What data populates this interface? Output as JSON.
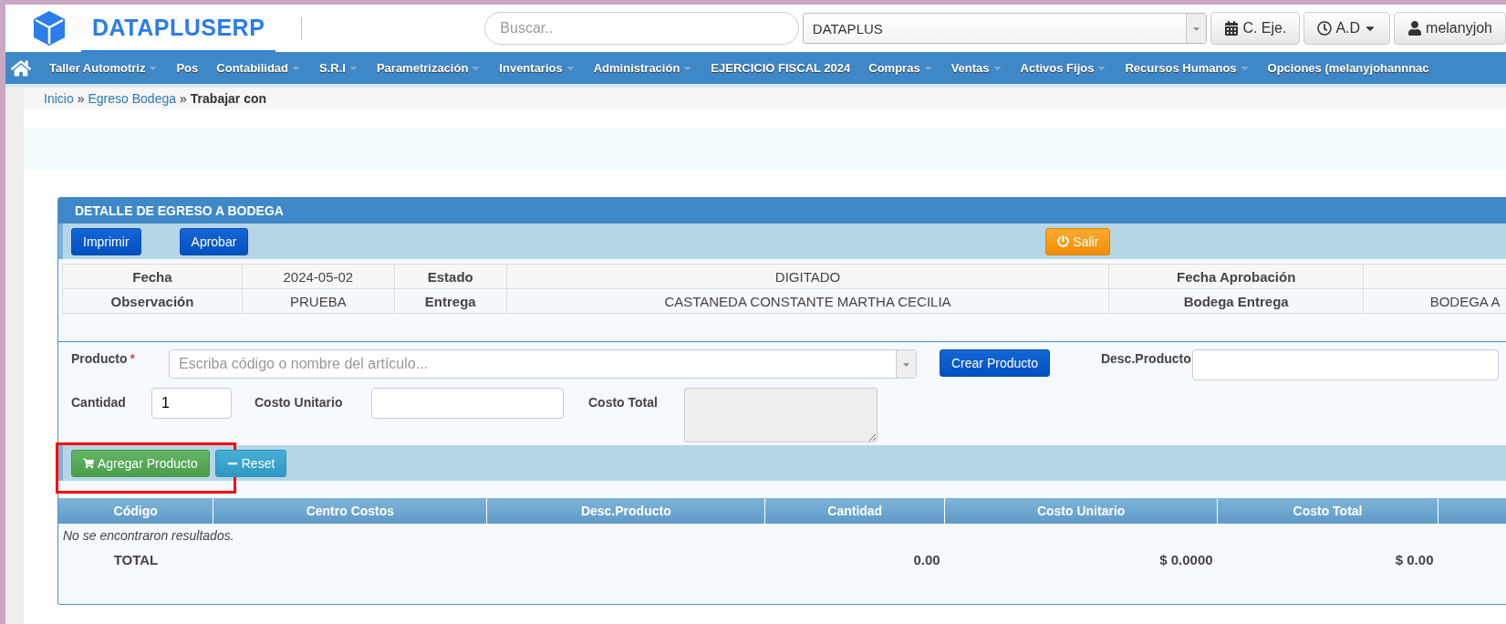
{
  "header": {
    "brand": "DATAPLUSERP",
    "search": {
      "placeholder": "Buscar.."
    },
    "company_select": {
      "value": "DATAPLUS"
    },
    "buttons": [
      {
        "kind": "calendar",
        "label": "C. Eje."
      },
      {
        "kind": "clock",
        "label": "A.D",
        "caret": true
      },
      {
        "kind": "user",
        "label": "melanyjoh"
      }
    ]
  },
  "nav": [
    {
      "label": "Taller Automotriz",
      "has_submenu": true
    },
    {
      "label": "Pos",
      "has_submenu": false
    },
    {
      "label": "Contabilidad",
      "has_submenu": true
    },
    {
      "label": "S.R.I",
      "has_submenu": true
    },
    {
      "label": "Parametrización",
      "has_submenu": true
    },
    {
      "label": "Inventarios",
      "has_submenu": true
    },
    {
      "label": "Administración",
      "has_submenu": true
    },
    {
      "label": "EJERCICIO FISCAL 2024",
      "has_submenu": false
    },
    {
      "label": "Compras",
      "has_submenu": true
    },
    {
      "label": "Ventas",
      "has_submenu": true
    },
    {
      "label": "Activos Fijos",
      "has_submenu": true
    },
    {
      "label": "Recursos Humanos",
      "has_submenu": true
    },
    {
      "label": "Opciones (melanyjohannnac",
      "has_submenu": false
    }
  ],
  "breadcrumb": [
    {
      "label": "Inicio",
      "link": true
    },
    {
      "label": "Egreso Bodega",
      "link": true
    },
    {
      "label": "Trabajar con",
      "link": false
    }
  ],
  "breadcrumb_separator": "»",
  "panel": {
    "title": "DETALLE DE EGRESO A BODEGA",
    "toolbar": [
      {
        "label": "Imprimir",
        "kind": "primary"
      },
      {
        "label": "Aprobar",
        "kind": "primary"
      },
      {
        "label": "Salir",
        "kind": "warning"
      }
    ],
    "info_rows": [
      [
        "Fecha",
        "2024-05-02",
        "Estado",
        "DIGITADO",
        "Fecha Aprobación",
        null
      ],
      [
        "Observación",
        "PRUEBA",
        "Entrega",
        "CASTANEDA CONSTANTE MARTHA CECILIA",
        "Bodega Entrega",
        "BODEGA A"
      ]
    ],
    "form": {
      "producto": {
        "label": "Producto",
        "required_mark": "*",
        "placeholder": "Escriba código o nombre del artículo..."
      },
      "crear_button": "Crear Producto",
      "desc": {
        "label": "Desc.Producto"
      },
      "cantidad": {
        "label": "Cantidad",
        "value": "1"
      },
      "costo_unitario": {
        "label": "Costo Unitario"
      },
      "costo_total": {
        "label": "Costo Total"
      }
    },
    "actions": [
      {
        "label": "Agregar Producto",
        "kind": "success",
        "highlighted": true
      },
      {
        "label": "Reset",
        "kind": "info",
        "highlighted": false
      }
    ],
    "table": {
      "columns": [
        "Código",
        "Centro Costos",
        "Desc.Producto",
        "Cantidad",
        "Costo Unitario",
        "Costo Total",
        ""
      ],
      "empty_message": "No se encontraron resultados.",
      "total_row": {
        "label": "TOTAL",
        "cantidad": "0.00",
        "costo_unitario": "$ 0.0000",
        "costo_total": "$ 0.00"
      }
    }
  }
}
